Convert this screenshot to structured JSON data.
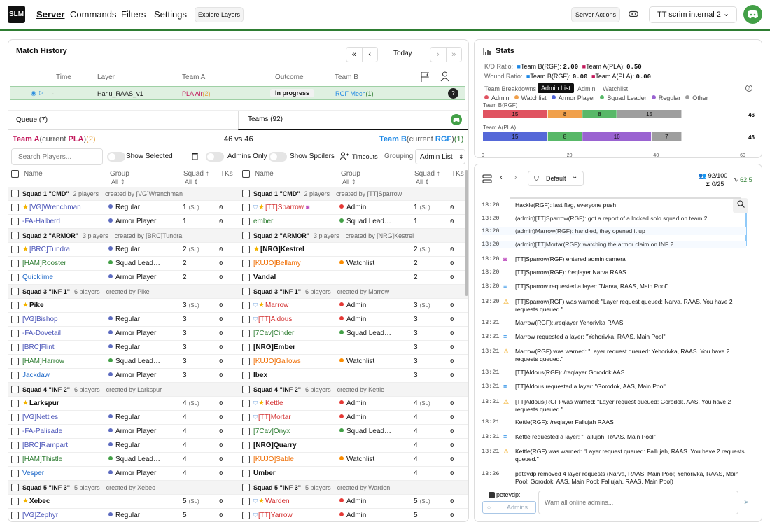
{
  "nav": {
    "logo": "SLM",
    "links": [
      "Server",
      "Commands",
      "Filters",
      "Settings"
    ],
    "explore": "Explore Layers",
    "server_actions": "Server Actions",
    "server_name": "TT scrim internal 2"
  },
  "match": {
    "title": "Match History",
    "today": "Today",
    "cols": [
      "Time",
      "Layer",
      "Team A",
      "Outcome",
      "Team B"
    ],
    "current": {
      "time": "-",
      "layer": "Harju_RAAS_v1",
      "team_a": "PLA Air",
      "team_a_n": "(2)",
      "outcome": "In progress",
      "team_b": "RGF Mech",
      "team_b_n": "(1)"
    }
  },
  "tabs": {
    "queue": "Queue (7)",
    "teams": "Teams (92)"
  },
  "teams": {
    "a_pre": "Team A",
    "a_mid": "(current ",
    "a_fac": "PLA",
    "a_close": ")",
    "a_cnt": "(2)",
    "vs": "46 vs 46",
    "b_pre": "Team B",
    "b_mid": "(current ",
    "b_fac": "RGF",
    "b_close": ")",
    "b_cnt": "(1)"
  },
  "toolbar": {
    "search_ph": "Search Players...",
    "show_selected": "Show Selected",
    "admins_only": "Admins Only",
    "show_spoilers": "Show Spoilers",
    "timeouts": "Timeouts",
    "grouping": "Grouping",
    "grouping_val": "Admin List"
  },
  "cols": {
    "name": "Name",
    "group": "Group",
    "squad": "Squad ↑",
    "tks": "TKs",
    "all": "All"
  },
  "rows_a": [
    {
      "t": "s",
      "name": "Squad 1 \"CMD\"",
      "n": "2 players",
      "by": "created by [VG]Wrenchman"
    },
    {
      "t": "p",
      "name": "[VG]Wrenchman",
      "star": true,
      "c": "#4a54b8",
      "group": "Regular",
      "gc": "#5c6bc0",
      "sq": "1",
      "sl": "(SL)",
      "tk": "0"
    },
    {
      "t": "p",
      "name": "-FA-Halberd",
      "c": "#4a54b8",
      "group": "Armor Player",
      "gc": "#5c6bc0",
      "sq": "1",
      "tk": "0"
    },
    {
      "t": "s",
      "name": "Squad 2 \"ARMOR\"",
      "n": "3 players",
      "by": "created by [BRC]Tundra"
    },
    {
      "t": "p",
      "name": "[BRC]Tundra",
      "star": true,
      "c": "#4a54b8",
      "group": "Regular",
      "gc": "#5c6bc0",
      "sq": "2",
      "sl": "(SL)",
      "tk": "0"
    },
    {
      "t": "p",
      "name": "[HAM]Rooster",
      "c": "#2e7d32",
      "group": "Squad Lead…",
      "gc": "#43a047",
      "sq": "2",
      "tk": "0"
    },
    {
      "t": "p",
      "name": "Quicklime",
      "c": "#1a66c7",
      "group": "Armor Player",
      "gc": "#5c6bc0",
      "sq": "2",
      "tk": "0"
    },
    {
      "t": "s",
      "name": "Squad 3 \"INF 1\"",
      "n": "6 players",
      "by": "created by Pike"
    },
    {
      "t": "p",
      "name": "Pike",
      "star": true,
      "c": "#111",
      "group": "",
      "sq": "3",
      "sl": "(SL)",
      "tk": "0"
    },
    {
      "t": "p",
      "name": "[VG]Bishop",
      "c": "#4a54b8",
      "group": "Regular",
      "gc": "#5c6bc0",
      "sq": "3",
      "tk": "0"
    },
    {
      "t": "p",
      "name": "-FA-Dovetail",
      "c": "#4a54b8",
      "group": "Armor Player",
      "gc": "#5c6bc0",
      "sq": "3",
      "tk": "0"
    },
    {
      "t": "p",
      "name": "[BRC]Flint",
      "c": "#4a54b8",
      "group": "Regular",
      "gc": "#5c6bc0",
      "sq": "3",
      "tk": "0"
    },
    {
      "t": "p",
      "name": "[HAM]Harrow",
      "c": "#2e7d32",
      "group": "Squad Lead…",
      "gc": "#43a047",
      "sq": "3",
      "tk": "0"
    },
    {
      "t": "p",
      "name": "Jackdaw",
      "c": "#1a66c7",
      "group": "Armor Player",
      "gc": "#5c6bc0",
      "sq": "3",
      "tk": "0"
    },
    {
      "t": "s",
      "name": "Squad 4 \"INF 2\"",
      "n": "6 players",
      "by": "created by Larkspur"
    },
    {
      "t": "p",
      "name": "Larkspur",
      "star": true,
      "c": "#111",
      "group": "",
      "sq": "4",
      "sl": "(SL)",
      "tk": "0"
    },
    {
      "t": "p",
      "name": "[VG]Nettles",
      "c": "#4a54b8",
      "group": "Regular",
      "gc": "#5c6bc0",
      "sq": "4",
      "tk": "0"
    },
    {
      "t": "p",
      "name": "-FA-Palisade",
      "c": "#4a54b8",
      "group": "Armor Player",
      "gc": "#5c6bc0",
      "sq": "4",
      "tk": "0"
    },
    {
      "t": "p",
      "name": "[BRC]Rampart",
      "c": "#4a54b8",
      "group": "Regular",
      "gc": "#5c6bc0",
      "sq": "4",
      "tk": "0"
    },
    {
      "t": "p",
      "name": "[HAM]Thistle",
      "c": "#2e7d32",
      "group": "Squad Lead…",
      "gc": "#43a047",
      "sq": "4",
      "tk": "0"
    },
    {
      "t": "p",
      "name": "Vesper",
      "c": "#1a66c7",
      "group": "Armor Player",
      "gc": "#5c6bc0",
      "sq": "4",
      "tk": "0"
    },
    {
      "t": "s",
      "name": "Squad 5 \"INF 3\"",
      "n": "5 players",
      "by": "created by Xebec"
    },
    {
      "t": "p",
      "name": "Xebec",
      "star": true,
      "c": "#111",
      "group": "",
      "sq": "5",
      "sl": "(SL)",
      "tk": "0"
    },
    {
      "t": "p",
      "name": "[VG]Zephyr",
      "c": "#4a54b8",
      "group": "Regular",
      "gc": "#5c6bc0",
      "sq": "5",
      "tk": "0"
    }
  ],
  "rows_b": [
    {
      "t": "s",
      "name": "Squad 1 \"CMD\"",
      "n": "2 players",
      "by": "created by [TT]Sparrow"
    },
    {
      "t": "p",
      "name": "[TT]Sparrow",
      "shield": true,
      "star": true,
      "cam": true,
      "c": "#d32f2f",
      "group": "Admin",
      "gc": "#e53935",
      "sq": "1",
      "sl": "(SL)",
      "tk": "0"
    },
    {
      "t": "p",
      "name": "ember",
      "c": "#2e7d32",
      "group": "Squad Lead…",
      "gc": "#43a047",
      "sq": "1",
      "tk": "0"
    },
    {
      "t": "s",
      "name": "Squad 2 \"ARMOR\"",
      "n": "3 players",
      "by": "created by [NRG]Kestrel"
    },
    {
      "t": "p",
      "name": "[NRG]Kestrel",
      "star": true,
      "c": "#111",
      "group": "",
      "sq": "2",
      "sl": "(SL)",
      "tk": "0"
    },
    {
      "t": "p",
      "name": "[KUJO]Bellamy",
      "c": "#ef6c00",
      "group": "Watchlist",
      "gc": "#fb8c00",
      "sq": "2",
      "tk": "0"
    },
    {
      "t": "p",
      "name": "Vandal",
      "c": "#111",
      "group": "",
      "sq": "2",
      "tk": "0"
    },
    {
      "t": "s",
      "name": "Squad 3 \"INF 1\"",
      "n": "6 players",
      "by": "created by Marrow"
    },
    {
      "t": "p",
      "name": "Marrow",
      "shield": true,
      "star": true,
      "c": "#d32f2f",
      "group": "Admin",
      "gc": "#e53935",
      "sq": "3",
      "sl": "(SL)",
      "tk": "0"
    },
    {
      "t": "p",
      "name": "[TT]Aldous",
      "shield": true,
      "c": "#d32f2f",
      "group": "Admin",
      "gc": "#e53935",
      "sq": "3",
      "tk": "0"
    },
    {
      "t": "p",
      "name": "[7Cav]Cinder",
      "c": "#2e7d32",
      "group": "Squad Lead…",
      "gc": "#43a047",
      "sq": "3",
      "tk": "0"
    },
    {
      "t": "p",
      "name": "[NRG]Ember",
      "c": "#111",
      "group": "",
      "sq": "3",
      "tk": "0"
    },
    {
      "t": "p",
      "name": "[KUJO]Gallows",
      "c": "#ef6c00",
      "group": "Watchlist",
      "gc": "#fb8c00",
      "sq": "3",
      "tk": "0"
    },
    {
      "t": "p",
      "name": "Ibex",
      "c": "#111",
      "group": "",
      "sq": "3",
      "tk": "0"
    },
    {
      "t": "s",
      "name": "Squad 4 \"INF 2\"",
      "n": "6 players",
      "by": "created by Kettle"
    },
    {
      "t": "p",
      "name": "Kettle",
      "shield": true,
      "star": true,
      "c": "#d32f2f",
      "group": "Admin",
      "gc": "#e53935",
      "sq": "4",
      "sl": "(SL)",
      "tk": "0"
    },
    {
      "t": "p",
      "name": "[TT]Mortar",
      "shield": true,
      "c": "#d32f2f",
      "group": "Admin",
      "gc": "#e53935",
      "sq": "4",
      "tk": "0"
    },
    {
      "t": "p",
      "name": "[7Cav]Onyx",
      "c": "#2e7d32",
      "group": "Squad Lead…",
      "gc": "#43a047",
      "sq": "4",
      "tk": "0"
    },
    {
      "t": "p",
      "name": "[NRG]Quarry",
      "c": "#111",
      "group": "",
      "sq": "4",
      "tk": "0"
    },
    {
      "t": "p",
      "name": "[KUJO]Sable",
      "c": "#ef6c00",
      "group": "Watchlist",
      "gc": "#fb8c00",
      "sq": "4",
      "tk": "0"
    },
    {
      "t": "p",
      "name": "Umber",
      "c": "#111",
      "group": "",
      "sq": "4",
      "tk": "0"
    },
    {
      "t": "s",
      "name": "Squad 5 \"INF 3\"",
      "n": "5 players",
      "by": "created by Warden"
    },
    {
      "t": "p",
      "name": "Warden",
      "shield": true,
      "star": true,
      "c": "#d32f2f",
      "group": "Admin",
      "gc": "#e53935",
      "sq": "5",
      "sl": "(SL)",
      "tk": "0"
    },
    {
      "t": "p",
      "name": "[TT]Yarrow",
      "shield": true,
      "c": "#d32f2f",
      "group": "Admin",
      "gc": "#e53935",
      "sq": "5",
      "tk": "0"
    }
  ],
  "stats": {
    "title": "Stats",
    "kd_label": "K/D Ratio:",
    "kd_b": "Team B(RGF):",
    "kd_b_v": "2.00",
    "kd_a": "Team A(PLA):",
    "kd_a_v": "0.50",
    "wr_label": "Wound Ratio:",
    "wr_b": "Team B(RGF):",
    "wr_b_v": "0.00",
    "wr_a": "Team A(PLA):",
    "wr_a_v": "0.00",
    "tabs": [
      "Team Breakdowns",
      "Admin List",
      "Admin",
      "Watchlist"
    ],
    "legend": [
      {
        "name": "Admin",
        "color": "#e05361"
      },
      {
        "name": "Watchlist",
        "color": "#f0a04b"
      },
      {
        "name": "Armor Player",
        "color": "#5568d8"
      },
      {
        "name": "Squad Leader",
        "color": "#58b868"
      },
      {
        "name": "Regular",
        "color": "#9a63d1"
      },
      {
        "name": "Other",
        "color": "#9e9e9e"
      }
    ]
  },
  "chart_data": {
    "type": "bar",
    "stacked": true,
    "orientation": "horizontal",
    "categories": [
      "Team B(RGF)",
      "Team A(PLA)"
    ],
    "series": [
      {
        "name": "Admin",
        "values": [
          15,
          0
        ]
      },
      {
        "name": "Watchlist",
        "values": [
          8,
          0
        ]
      },
      {
        "name": "Armor Player",
        "values": [
          0,
          15
        ]
      },
      {
        "name": "Squad Leader",
        "values": [
          8,
          8
        ]
      },
      {
        "name": "Regular",
        "values": [
          0,
          16
        ]
      },
      {
        "name": "Other",
        "values": [
          15,
          7
        ]
      }
    ],
    "totals": [
      "46",
      "46"
    ],
    "xticks": [
      "0",
      "20",
      "40",
      "60"
    ],
    "xlim": [
      0,
      60
    ]
  },
  "chat": {
    "preset": "Default",
    "count": "92/100",
    "queue": "0/25",
    "fps": "62.5",
    "input_ph": "Warn all online admins...",
    "sender": "petevdp:",
    "channel": "Admins",
    "lines": [
      {
        "ts": "13:20",
        "text": "Hackle(RGF): last flag, everyone push"
      },
      {
        "ts": "13:20",
        "text": "(admin)[TT]Sparrow(RGF): got a report of a locked solo squad on team 2"
      },
      {
        "ts": "13:20",
        "text": "(admin)Marrow(RGF): handled, they opened it up"
      },
      {
        "ts": "13:20",
        "text": "(admin)[TT]Mortar(RGF): watching the armor claim on INF 2"
      },
      {
        "ts": "13:20",
        "text": "[TT]Sparrow(RGF) entered admin camera"
      },
      {
        "ts": "13:20",
        "text": "[TT]Sparrow(RGF): /reqlayer Narva RAAS"
      },
      {
        "ts": "13:20",
        "text": "[TT]Sparrow requested a layer: \"Narva, RAAS, Main Pool\""
      },
      {
        "ts": "13:20",
        "text": "[TT]Sparrow(RGF) was warned: \"Layer request queued: Narva, RAAS. You have 2 requests queued.\""
      },
      {
        "ts": "13:21",
        "text": "Marrow(RGF): /reqlayer Yehorivka RAAS"
      },
      {
        "ts": "13:21",
        "text": "Marrow requested a layer: \"Yehorivka, RAAS, Main Pool\""
      },
      {
        "ts": "13:21",
        "text": "Marrow(RGF) was warned: \"Layer request queued: Yehorivka, RAAS. You have 2 requests queued.\""
      },
      {
        "ts": "13:21",
        "text": "[TT]Aldous(RGF): /reqlayer Gorodok AAS"
      },
      {
        "ts": "13:21",
        "text": "[TT]Aldous requested a layer: \"Gorodok, AAS, Main Pool\""
      },
      {
        "ts": "13:21",
        "text": "[TT]Aldous(RGF) was warned: \"Layer request queued: Gorodok, AAS. You have 2 requests queued.\""
      },
      {
        "ts": "13:21",
        "text": "Kettle(RGF): /reqlayer Fallujah RAAS"
      },
      {
        "ts": "13:21",
        "text": "Kettle requested a layer: \"Fallujah, RAAS, Main Pool\""
      },
      {
        "ts": "13:21",
        "text": "Kettle(RGF) was warned: \"Layer request queued: Fallujah, RAAS. You have 2 requests queued.\""
      },
      {
        "ts": "13:26",
        "text": "petevdp removed 4 layer requests (Narva, RAAS, Main Pool; Yehorivka, RAAS, Main Pool; Gorodok, AAS, Main Pool; Fallujah, RAAS, Main Pool)"
      }
    ]
  }
}
